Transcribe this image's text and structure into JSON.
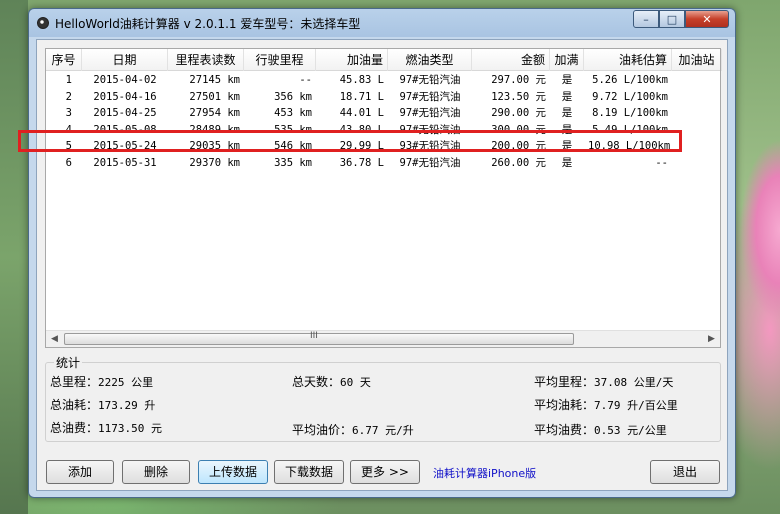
{
  "window": {
    "title": "HelloWorld油耗计算器 v 2.0.1.1  爱车型号：未选择车型",
    "min_glyph": "–",
    "max_glyph": "□",
    "close_glyph": "✕"
  },
  "table": {
    "columns": [
      "序号",
      "日期",
      "里程表读数",
      "行驶里程",
      "加油量",
      "燃油类型",
      "金额",
      "加满",
      "油耗估算",
      "加油站"
    ],
    "rows": [
      {
        "no": "1",
        "date": "2015-04-02",
        "odometer": "27145 km",
        "distance": "--",
        "fuel": "45.83 L",
        "type": "97#无铅汽油",
        "amount": "297.00 元",
        "full": "是",
        "estimate": "5.26 L/100km",
        "station": ""
      },
      {
        "no": "2",
        "date": "2015-04-16",
        "odometer": "27501 km",
        "distance": "356 km",
        "fuel": "18.71 L",
        "type": "97#无铅汽油",
        "amount": "123.50 元",
        "full": "是",
        "estimate": "9.72 L/100km",
        "station": ""
      },
      {
        "no": "3",
        "date": "2015-04-25",
        "odometer": "27954 km",
        "distance": "453 km",
        "fuel": "44.01 L",
        "type": "97#无铅汽油",
        "amount": "290.00 元",
        "full": "是",
        "estimate": "8.19 L/100km",
        "station": ""
      },
      {
        "no": "4",
        "date": "2015-05-08",
        "odometer": "28489 km",
        "distance": "535 km",
        "fuel": "43.80 L",
        "type": "97#无铅汽油",
        "amount": "300.00 元",
        "full": "是",
        "estimate": "5.49 L/100km",
        "station": ""
      },
      {
        "no": "5",
        "date": "2015-05-24",
        "odometer": "29035 km",
        "distance": "546 km",
        "fuel": "29.99 L",
        "type": "93#无铅汽油",
        "amount": "200.00 元",
        "full": "是",
        "estimate": "10.98 L/100km",
        "station": ""
      },
      {
        "no": "6",
        "date": "2015-05-31",
        "odometer": "29370 km",
        "distance": "335 km",
        "fuel": "36.78 L",
        "type": "97#无铅汽油",
        "amount": "260.00 元",
        "full": "是",
        "estimate": "--",
        "station": ""
      }
    ],
    "highlight_color": "#e02020",
    "scroll_grip": "III",
    "scroll_left": "◀",
    "scroll_right": "▶"
  },
  "stats": {
    "group_label": "统计",
    "total_distance_label": "总里程：",
    "total_distance_value": "2225 公里",
    "total_days_label": "总天数：",
    "total_days_value": "60 天",
    "avg_distance_label": "平均里程：",
    "avg_distance_value": "37.08 公里/天",
    "total_fuel_label": "总油耗：",
    "total_fuel_value": "173.29 升",
    "avg_fuel_label": "平均油耗：",
    "avg_fuel_value": "7.79 升/百公里",
    "total_cost_label": "总油费：",
    "total_cost_value": "1173.50 元",
    "avg_price_label": "平均油价：",
    "avg_price_value": "6.77 元/升",
    "avg_cost_label": "平均油费：",
    "avg_cost_value": "0.53 元/公里"
  },
  "buttons": {
    "add": "添加",
    "delete": "删除",
    "upload": "上传数据",
    "download": "下载数据",
    "more": "更多 >>",
    "iphone_link": "油耗计算器iPhone版",
    "exit": "退出"
  }
}
